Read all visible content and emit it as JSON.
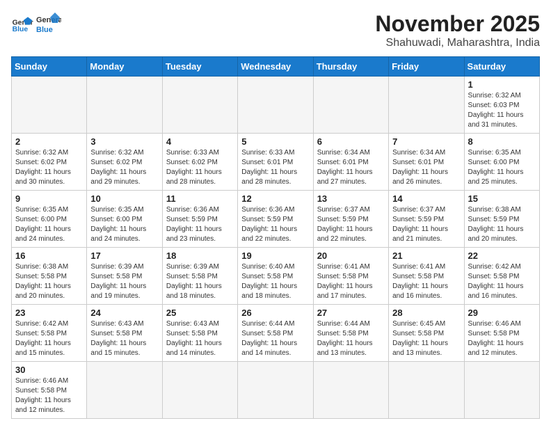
{
  "header": {
    "logo_text_general": "General",
    "logo_text_blue": "Blue",
    "title": "November 2025",
    "subtitle": "Shahuwadi, Maharashtra, India"
  },
  "weekdays": [
    "Sunday",
    "Monday",
    "Tuesday",
    "Wednesday",
    "Thursday",
    "Friday",
    "Saturday"
  ],
  "weeks": [
    [
      {
        "day": "",
        "info": ""
      },
      {
        "day": "",
        "info": ""
      },
      {
        "day": "",
        "info": ""
      },
      {
        "day": "",
        "info": ""
      },
      {
        "day": "",
        "info": ""
      },
      {
        "day": "",
        "info": ""
      },
      {
        "day": "1",
        "info": "Sunrise: 6:32 AM\nSunset: 6:03 PM\nDaylight: 11 hours\nand 31 minutes."
      }
    ],
    [
      {
        "day": "2",
        "info": "Sunrise: 6:32 AM\nSunset: 6:02 PM\nDaylight: 11 hours\nand 30 minutes."
      },
      {
        "day": "3",
        "info": "Sunrise: 6:32 AM\nSunset: 6:02 PM\nDaylight: 11 hours\nand 29 minutes."
      },
      {
        "day": "4",
        "info": "Sunrise: 6:33 AM\nSunset: 6:02 PM\nDaylight: 11 hours\nand 28 minutes."
      },
      {
        "day": "5",
        "info": "Sunrise: 6:33 AM\nSunset: 6:01 PM\nDaylight: 11 hours\nand 28 minutes."
      },
      {
        "day": "6",
        "info": "Sunrise: 6:34 AM\nSunset: 6:01 PM\nDaylight: 11 hours\nand 27 minutes."
      },
      {
        "day": "7",
        "info": "Sunrise: 6:34 AM\nSunset: 6:01 PM\nDaylight: 11 hours\nand 26 minutes."
      },
      {
        "day": "8",
        "info": "Sunrise: 6:35 AM\nSunset: 6:00 PM\nDaylight: 11 hours\nand 25 minutes."
      }
    ],
    [
      {
        "day": "9",
        "info": "Sunrise: 6:35 AM\nSunset: 6:00 PM\nDaylight: 11 hours\nand 24 minutes."
      },
      {
        "day": "10",
        "info": "Sunrise: 6:35 AM\nSunset: 6:00 PM\nDaylight: 11 hours\nand 24 minutes."
      },
      {
        "day": "11",
        "info": "Sunrise: 6:36 AM\nSunset: 5:59 PM\nDaylight: 11 hours\nand 23 minutes."
      },
      {
        "day": "12",
        "info": "Sunrise: 6:36 AM\nSunset: 5:59 PM\nDaylight: 11 hours\nand 22 minutes."
      },
      {
        "day": "13",
        "info": "Sunrise: 6:37 AM\nSunset: 5:59 PM\nDaylight: 11 hours\nand 22 minutes."
      },
      {
        "day": "14",
        "info": "Sunrise: 6:37 AM\nSunset: 5:59 PM\nDaylight: 11 hours\nand 21 minutes."
      },
      {
        "day": "15",
        "info": "Sunrise: 6:38 AM\nSunset: 5:59 PM\nDaylight: 11 hours\nand 20 minutes."
      }
    ],
    [
      {
        "day": "16",
        "info": "Sunrise: 6:38 AM\nSunset: 5:58 PM\nDaylight: 11 hours\nand 20 minutes."
      },
      {
        "day": "17",
        "info": "Sunrise: 6:39 AM\nSunset: 5:58 PM\nDaylight: 11 hours\nand 19 minutes."
      },
      {
        "day": "18",
        "info": "Sunrise: 6:39 AM\nSunset: 5:58 PM\nDaylight: 11 hours\nand 18 minutes."
      },
      {
        "day": "19",
        "info": "Sunrise: 6:40 AM\nSunset: 5:58 PM\nDaylight: 11 hours\nand 18 minutes."
      },
      {
        "day": "20",
        "info": "Sunrise: 6:41 AM\nSunset: 5:58 PM\nDaylight: 11 hours\nand 17 minutes."
      },
      {
        "day": "21",
        "info": "Sunrise: 6:41 AM\nSunset: 5:58 PM\nDaylight: 11 hours\nand 16 minutes."
      },
      {
        "day": "22",
        "info": "Sunrise: 6:42 AM\nSunset: 5:58 PM\nDaylight: 11 hours\nand 16 minutes."
      }
    ],
    [
      {
        "day": "23",
        "info": "Sunrise: 6:42 AM\nSunset: 5:58 PM\nDaylight: 11 hours\nand 15 minutes."
      },
      {
        "day": "24",
        "info": "Sunrise: 6:43 AM\nSunset: 5:58 PM\nDaylight: 11 hours\nand 15 minutes."
      },
      {
        "day": "25",
        "info": "Sunrise: 6:43 AM\nSunset: 5:58 PM\nDaylight: 11 hours\nand 14 minutes."
      },
      {
        "day": "26",
        "info": "Sunrise: 6:44 AM\nSunset: 5:58 PM\nDaylight: 11 hours\nand 14 minutes."
      },
      {
        "day": "27",
        "info": "Sunrise: 6:44 AM\nSunset: 5:58 PM\nDaylight: 11 hours\nand 13 minutes."
      },
      {
        "day": "28",
        "info": "Sunrise: 6:45 AM\nSunset: 5:58 PM\nDaylight: 11 hours\nand 13 minutes."
      },
      {
        "day": "29",
        "info": "Sunrise: 6:46 AM\nSunset: 5:58 PM\nDaylight: 11 hours\nand 12 minutes."
      }
    ],
    [
      {
        "day": "30",
        "info": "Sunrise: 6:46 AM\nSunset: 5:58 PM\nDaylight: 11 hours\nand 12 minutes."
      },
      {
        "day": "",
        "info": ""
      },
      {
        "day": "",
        "info": ""
      },
      {
        "day": "",
        "info": ""
      },
      {
        "day": "",
        "info": ""
      },
      {
        "day": "",
        "info": ""
      },
      {
        "day": "",
        "info": ""
      }
    ]
  ]
}
